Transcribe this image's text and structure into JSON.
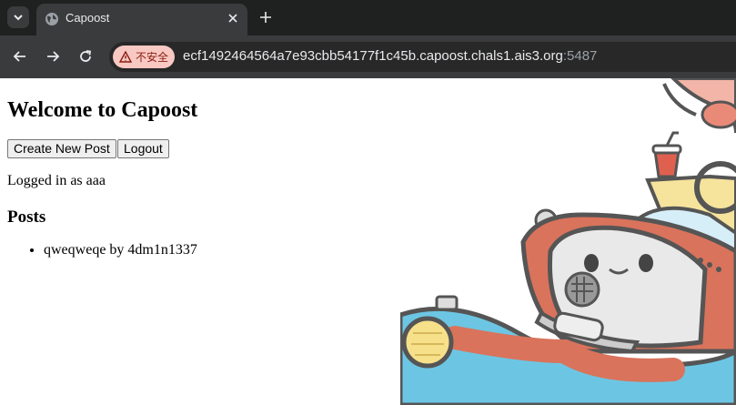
{
  "browser": {
    "tab": {
      "title": "Capoost",
      "favicon": "globe-icon"
    },
    "security_label": "不安全",
    "url_host": "ecf1492464564a7e93cbb54177f1c45b.capoost.chals1.ais3.org",
    "url_port": ":5487",
    "icons": [
      "tab-search-icon",
      "close-icon",
      "plus-icon",
      "back-arrow-icon",
      "forward-arrow-icon",
      "reload-icon",
      "warning-icon"
    ]
  },
  "page": {
    "heading": "Welcome to Capoost",
    "buttons": {
      "create_post": "Create New Post",
      "logout": "Logout"
    },
    "logged_in_text": "Logged in as aaa",
    "posts_heading": "Posts",
    "posts": [
      {
        "text": "qweqweqe by 4dm1n1337"
      }
    ]
  },
  "colors": {
    "chrome_dark": "#1f2020",
    "chrome_toolbar": "#3a3b3c",
    "security_chip": "#f8c9c2",
    "car_body": "#6cc6e3",
    "car_red": "#d9735c"
  }
}
